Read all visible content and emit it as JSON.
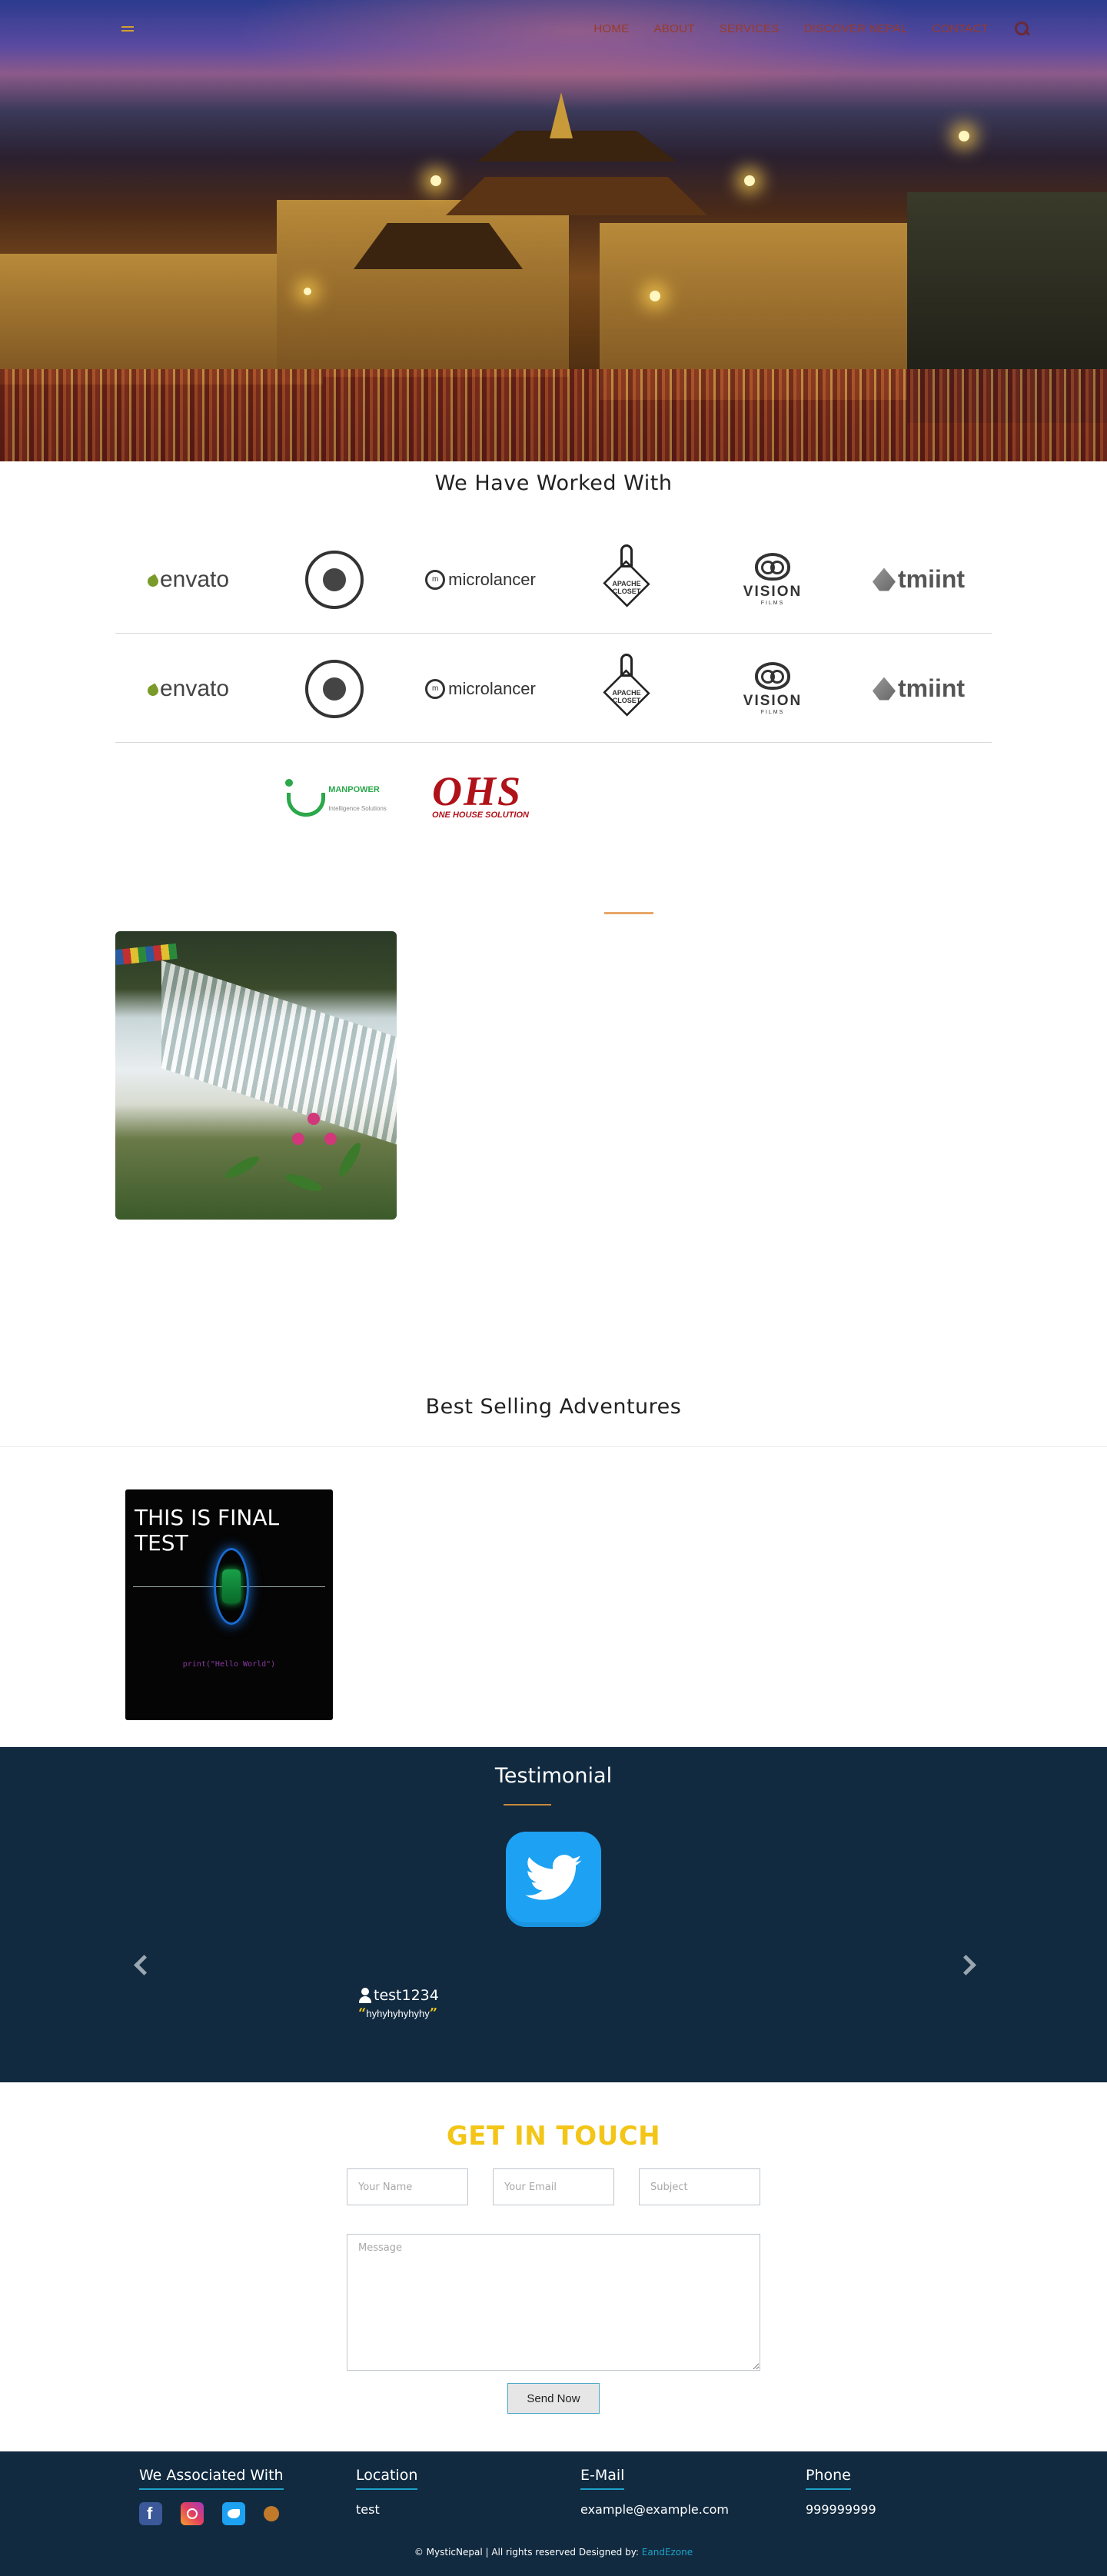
{
  "nav": {
    "items": [
      "HOME",
      "ABOUT",
      "SERVICES",
      "DISCOVER NEPAL",
      "CONTACT"
    ]
  },
  "partners": {
    "title": "We Have Worked With",
    "row_logos": [
      "envato",
      "coffee-roasters-badge",
      "microlancer",
      "apache-closet",
      "vision-films",
      "tmiint"
    ],
    "logo_texts": {
      "envato": "envato",
      "microlancer": "microlancer",
      "apache": "APACHE CLOSET",
      "vision": "VISION",
      "vision_sub": "FILMS",
      "tmiint": "tmiint",
      "manpower": "MANPOWER",
      "manpower_sub": "Intelligence Solutions",
      "ohs": "OHS",
      "ohs_sub": "ONE HOUSE SOLUTION"
    }
  },
  "adventures": {
    "title": "Best Selling Adventures",
    "card": {
      "title": "THIS IS FINAL TEST",
      "code": "print(\"Hello World\")"
    }
  },
  "testimonial": {
    "title": "Testimonial",
    "user": "test1234",
    "quote": "hyhyhyhyhyhy"
  },
  "contact": {
    "title": "GET IN TOUCH",
    "name_placeholder": "Your Name",
    "email_placeholder": "Your Email",
    "subject_placeholder": "Subject",
    "message_placeholder": "Message",
    "send_label": "Send Now"
  },
  "footer": {
    "associated_title": "We Associated With",
    "location_title": "Location",
    "location_value": "test",
    "email_title": "E-Mail",
    "email_value": "example@example.com",
    "phone_title": "Phone",
    "phone_value": "999999999",
    "copyright": "© MysticNepal | All rights reserved Designed by: ",
    "designer": "EandEzone",
    "social_icons": [
      "facebook-icon",
      "instagram-icon",
      "twitter-icon",
      "other-icon"
    ]
  },
  "colors": {
    "navy": "#112a40",
    "gold": "#f3c517",
    "accent": "#e8a66a",
    "link": "#1fa2c8"
  }
}
